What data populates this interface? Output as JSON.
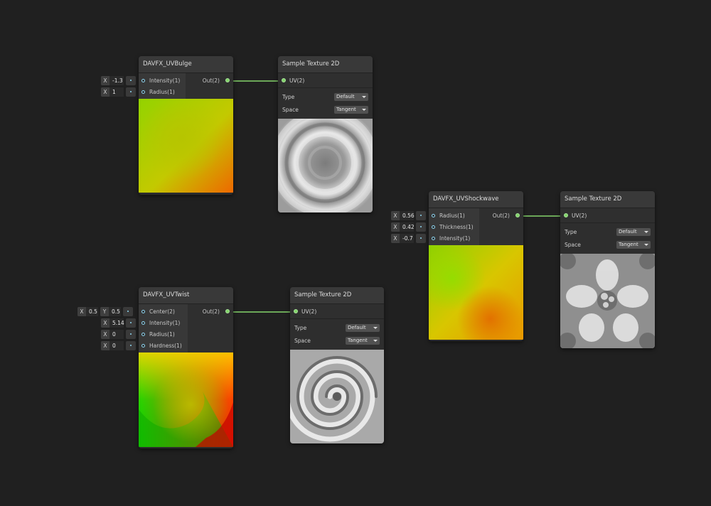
{
  "colors": {
    "background": "#202020",
    "input_port": "#8fd7f2",
    "output_port": "#84d46b",
    "edge": "#84d46b"
  },
  "nodes": {
    "bulge": {
      "title": "DAVFX_UVBulge",
      "inputs": [
        {
          "label": "Intensity(1)",
          "fields": [
            {
              "axis": "X",
              "value": "-1.3"
            }
          ]
        },
        {
          "label": "Radius(1)",
          "fields": [
            {
              "axis": "X",
              "value": "1"
            }
          ]
        }
      ],
      "output": "Out(2)"
    },
    "twist": {
      "title": "DAVFX_UVTwist",
      "inputs": [
        {
          "label": "Center(2)",
          "fields": [
            {
              "axis": "X",
              "value": "0.5"
            },
            {
              "axis": "Y",
              "value": "0.5"
            }
          ]
        },
        {
          "label": "Intensity(1)",
          "fields": [
            {
              "axis": "X",
              "value": "5.14"
            }
          ]
        },
        {
          "label": "Radius(1)",
          "fields": [
            {
              "axis": "X",
              "value": "0"
            }
          ]
        },
        {
          "label": "Hardness(1)",
          "fields": [
            {
              "axis": "X",
              "value": "0"
            }
          ]
        }
      ],
      "output": "Out(2)"
    },
    "shockwave": {
      "title": "DAVFX_UVShockwave",
      "inputs": [
        {
          "label": "Radius(1)",
          "fields": [
            {
              "axis": "X",
              "value": "0.56"
            }
          ]
        },
        {
          "label": "Thickness(1)",
          "fields": [
            {
              "axis": "X",
              "value": "0.42"
            }
          ]
        },
        {
          "label": "Intensity(1)",
          "fields": [
            {
              "axis": "X",
              "value": "-0.7"
            }
          ]
        }
      ],
      "output": "Out(2)"
    },
    "sample1": {
      "title": "Sample Texture 2D",
      "input": "UV(2)",
      "type_label": "Type",
      "type_value": "Default",
      "space_label": "Space",
      "space_value": "Tangent"
    },
    "sample2": {
      "title": "Sample Texture 2D",
      "input": "UV(2)",
      "type_label": "Type",
      "type_value": "Default",
      "space_label": "Space",
      "space_value": "Tangent"
    },
    "sample3": {
      "title": "Sample Texture 2D",
      "input": "UV(2)",
      "type_label": "Type",
      "type_value": "Default",
      "space_label": "Space",
      "space_value": "Tangent"
    }
  }
}
